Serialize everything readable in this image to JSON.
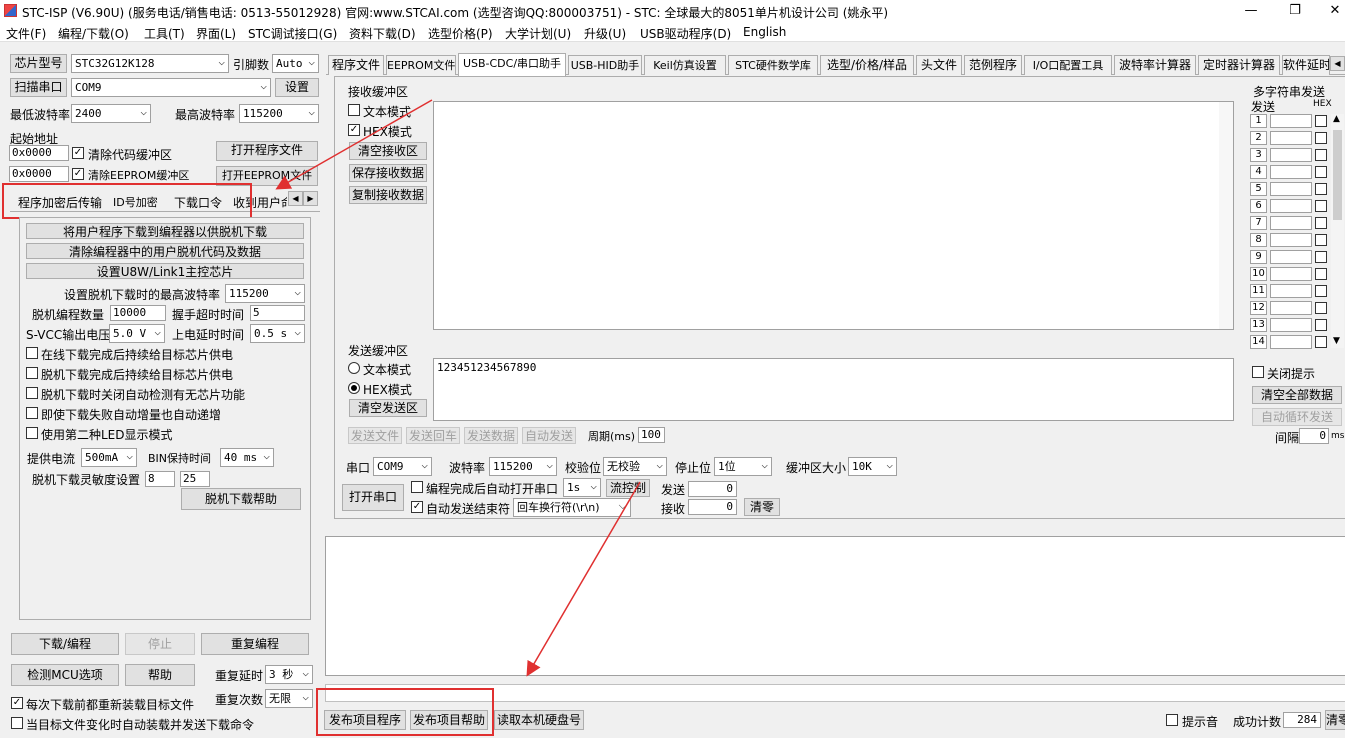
{
  "window": {
    "title": "STC-ISP (V6.90U) (服务电话/销售电话: 0513-55012928) 官网:www.STCAI.com (选型咨询QQ:800003751) - STC: 全球最大的8051单片机设计公司 (姚永平)",
    "minimize": "—",
    "restore": "❐",
    "close": "✕"
  },
  "menu": [
    "文件(F)",
    "编程/下载(O)",
    "工具(T)",
    "界面(L)",
    "STC调试接口(G)",
    "资料下载(D)",
    "选型价格(P)",
    "大学计划(U)",
    "升级(U)",
    "USB驱动程序(D)",
    "English"
  ],
  "left": {
    "chip_label": "芯片型号",
    "chip_value": "STC32G12K128",
    "pin_label": "引脚数",
    "pin_value": "Auto",
    "scan_label": "扫描串口",
    "port_value": "COM9",
    "settings_label": "设置",
    "min_baud_label": "最低波特率",
    "min_baud_value": "2400",
    "max_baud_label": "最高波特率",
    "max_baud_value": "115200",
    "start_addr_label": "起始地址",
    "addr1": "0x0000",
    "clear_code": "清除代码缓冲区",
    "open_program": "打开程序文件",
    "addr2": "0x0000",
    "clear_eeprom": "清除EEPROM缓冲区",
    "open_eeprom": "打开EEPROM文件",
    "subtabs": [
      "程序加密后传输",
      "ID号加密",
      "下载口令",
      "收到用户命"
    ],
    "offline": {
      "btn1": "将用户程序下载到编程器以供脱机下载",
      "btn2": "清除编程器中的用户脱机代码及数据",
      "btn3": "设置U8W/Link1主控芯片",
      "max_baud_label": "设置脱机下载时的最高波特率",
      "max_baud_value": "115200",
      "count_label": "脱机编程数量",
      "count_value": "10000",
      "handshake_label": "握手超时时间",
      "handshake_value": "5",
      "svcc_label": "S-VCC输出电压",
      "svcc_value": "5.0 V",
      "power_delay_label": "上电延时时间",
      "power_delay_value": "0.5 s",
      "opts": [
        "在线下载完成后持续给目标芯片供电",
        "脱机下载完成后持续给目标芯片供电",
        "脱机下载时关闭自动检测有无芯片功能",
        "即使下载失败自动增量也自动递增",
        "使用第二种LED显示模式"
      ],
      "current_label": "提供电流",
      "current_value": "500mA",
      "bin_label": "BIN保持时间",
      "bin_value": "40 ms",
      "sens_label": "脱机下载灵敏度设置",
      "sens1": "8",
      "sens2": "25",
      "help": "脱机下载帮助"
    },
    "download": "下载/编程",
    "stop": "停止",
    "reprogram": "重复编程",
    "detect": "检测MCU选项",
    "help": "帮助",
    "repeat_delay_label": "重复延时",
    "repeat_delay_value": "3 秒",
    "repeat_count_label": "重复次数",
    "repeat_count_value": "无限",
    "reload_each": "每次下载前都重新装载目标文件",
    "auto_reload": "当目标文件变化时自动装载并发送下载命令"
  },
  "tabs": [
    "程序文件",
    "EEPROM文件",
    "USB-CDC/串口助手",
    "USB-HID助手",
    "Keil仿真设置",
    "STC硬件数学库",
    "选型/价格/样品",
    "头文件",
    "范例程序",
    "I/O口配置工具",
    "波特率计算器",
    "定时器计算器",
    "软件延时"
  ],
  "serial": {
    "recv_title": "接收缓冲区",
    "text_mode": "文本模式",
    "hex_mode": "HEX模式",
    "clear_recv": "清空接收区",
    "save_recv": "保存接收数据",
    "copy_recv": "复制接收数据",
    "send_title": "发送缓冲区",
    "send_text_mode": "文本模式",
    "send_hex_mode": "HEX模式",
    "clear_send": "清空发送区",
    "send_data_value": "123451234567890",
    "send_file": "发送文件",
    "send_back": "发送回车",
    "send_data": "发送数据",
    "auto_send": "自动发送",
    "period_label": "周期(ms)",
    "period_value": "100",
    "port_label": "串口",
    "port_value": "COM9",
    "baud_label": "波特率",
    "baud_value": "115200",
    "parity_label": "校验位",
    "parity_value": "无校验",
    "stop_label": "停止位",
    "stop_value": "1位",
    "bufsize_label": "缓冲区大小",
    "bufsize_value": "10K",
    "open_port": "打开串口",
    "auto_open": "编程完成后自动打开串口",
    "auto_open_delay": "1s",
    "flow_ctrl": "流控制",
    "send_count_label": "发送",
    "send_count": "0",
    "recv_count_label": "接收",
    "recv_count": "0",
    "clear_count": "清零",
    "auto_end": "自动发送结束符",
    "end_char": "回车换行符(\\r\\n)"
  },
  "multi": {
    "title": "多字符串发送",
    "send_col": "发送",
    "hex_col": "HEX",
    "rows": [
      "1",
      "2",
      "3",
      "4",
      "5",
      "6",
      "7",
      "8",
      "9",
      "10",
      "11",
      "12",
      "13",
      "14"
    ],
    "close_tip": "关闭提示",
    "clear_all": "清空全部数据",
    "auto_loop": "自动循环发送",
    "interval_label": "间隔",
    "interval_value": "0",
    "interval_unit": "ms"
  },
  "bottom": {
    "publish_program": "发布项目程序",
    "publish_help": "发布项目帮助",
    "read_disk": "读取本机硬盘号",
    "beep": "提示音",
    "success_label": "成功计数",
    "success_value": "284",
    "clear": "清零"
  },
  "colors": {
    "highlight": "#e03030"
  }
}
